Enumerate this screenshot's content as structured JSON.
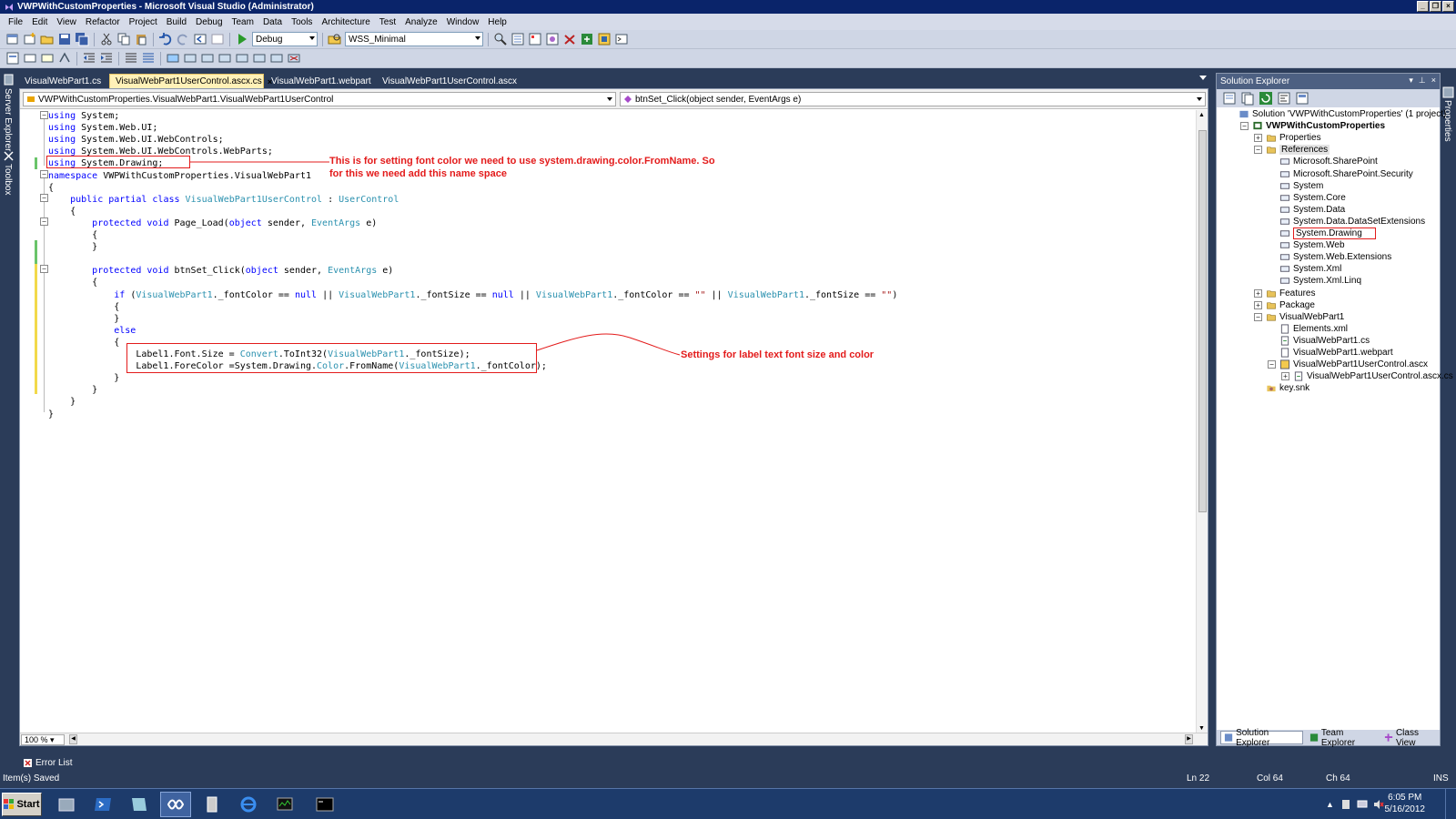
{
  "window": {
    "title": "VWPWithCustomProperties - Microsoft Visual Studio (Administrator)"
  },
  "menu": [
    "File",
    "Edit",
    "View",
    "Refactor",
    "Project",
    "Build",
    "Debug",
    "Team",
    "Data",
    "Tools",
    "Architecture",
    "Test",
    "Analyze",
    "Window",
    "Help"
  ],
  "toolbar": {
    "config": "Debug",
    "platform": "WSS_Minimal"
  },
  "side_tabs": {
    "server_explorer": "Server Explorer",
    "toolbox": "Toolbox",
    "properties": "Properties"
  },
  "tabs": [
    {
      "label": "VisualWebPart1.cs"
    },
    {
      "label": "VisualWebPart1UserControl.ascx.cs",
      "close": "×"
    },
    {
      "label": "VisualWebPart1.webpart"
    },
    {
      "label": "VisualWebPart1UserControl.ascx"
    }
  ],
  "nav": {
    "type": "VWPWithCustomProperties.VisualWebPart1.VisualWebPart1UserControl",
    "member": "btnSet_Click(object sender, EventArgs e)"
  },
  "code": [
    {
      "t": [
        [
          "kw",
          "using"
        ],
        [
          "",
          "System;"
        ]
      ]
    },
    {
      "t": [
        [
          "kw",
          "using"
        ],
        [
          "",
          "System.Web.UI;"
        ]
      ]
    },
    {
      "t": [
        [
          "kw",
          "using"
        ],
        [
          "",
          "System.Web.UI.WebControls;"
        ]
      ]
    },
    {
      "t": [
        [
          "kw",
          "using"
        ],
        [
          "",
          "System.Web.UI.WebControls.WebParts;"
        ]
      ]
    },
    {
      "t": [
        [
          "kw",
          "using"
        ],
        [
          "",
          "System.Drawing;"
        ]
      ]
    },
    {
      "t": [
        [
          "kw",
          "namespace"
        ],
        [
          "",
          "VWPWithCustomProperties.VisualWebPart1"
        ]
      ]
    },
    {
      "t": [
        [
          "",
          "{"
        ]
      ]
    },
    {
      "t": [
        [
          "",
          "    "
        ],
        [
          "kw",
          "public partial class"
        ],
        [
          "",
          " "
        ],
        [
          "ty",
          "VisualWebPart1UserControl"
        ],
        [
          "",
          " : "
        ],
        [
          "ty",
          "UserControl"
        ]
      ]
    },
    {
      "t": [
        [
          "",
          "    {"
        ]
      ]
    },
    {
      "t": [
        [
          "",
          "        "
        ],
        [
          "kw",
          "protected void"
        ],
        [
          "",
          " Page_Load("
        ],
        [
          "kw",
          "object"
        ],
        [
          "",
          " sender, "
        ],
        [
          "ty",
          "EventArgs"
        ],
        [
          "",
          " e)"
        ]
      ]
    },
    {
      "t": [
        [
          "",
          "        {"
        ]
      ]
    },
    {
      "t": [
        [
          "",
          "        }"
        ]
      ]
    },
    {
      "t": [
        [
          "",
          ""
        ]
      ]
    },
    {
      "t": [
        [
          "",
          "        "
        ],
        [
          "kw",
          "protected void"
        ],
        [
          "",
          " btnSet_Click("
        ],
        [
          "kw",
          "object"
        ],
        [
          "",
          " sender, "
        ],
        [
          "ty",
          "EventArgs"
        ],
        [
          "",
          " e)"
        ]
      ]
    },
    {
      "t": [
        [
          "",
          "        {"
        ]
      ]
    },
    {
      "t": [
        [
          "",
          "            "
        ],
        [
          "kw",
          "if"
        ],
        [
          "",
          " ("
        ],
        [
          "ty",
          "VisualWebPart1"
        ],
        [
          "",
          "._fontColor == "
        ],
        [
          "kw",
          "null"
        ],
        [
          "",
          " || "
        ],
        [
          "ty",
          "VisualWebPart1"
        ],
        [
          "",
          "._fontSize == "
        ],
        [
          "kw",
          "null"
        ],
        [
          "",
          " || "
        ],
        [
          "ty",
          "VisualWebPart1"
        ],
        [
          "",
          "._fontColor == "
        ],
        [
          "str",
          "\"\""
        ],
        [
          "",
          " || "
        ],
        [
          "ty",
          "VisualWebPart1"
        ],
        [
          "",
          "._fontSize == "
        ],
        [
          "str",
          "\"\""
        ],
        [
          "",
          ")"
        ]
      ]
    },
    {
      "t": [
        [
          "",
          "            {"
        ]
      ]
    },
    {
      "t": [
        [
          "",
          "            }"
        ]
      ]
    },
    {
      "t": [
        [
          "",
          "            "
        ],
        [
          "kw",
          "else"
        ]
      ]
    },
    {
      "t": [
        [
          "",
          "            {"
        ]
      ]
    },
    {
      "t": [
        [
          "",
          "                Label1.Font.Size = "
        ],
        [
          "ty",
          "Convert"
        ],
        [
          "",
          ".ToInt32("
        ],
        [
          "ty",
          "VisualWebPart1"
        ],
        [
          "",
          "._fontSize);"
        ]
      ]
    },
    {
      "t": [
        [
          "",
          "                Label1.ForeColor =System.Drawing."
        ],
        [
          "ty",
          "Color"
        ],
        [
          "",
          ".FromName("
        ],
        [
          "ty",
          "VisualWebPart1"
        ],
        [
          "",
          "._fontColor);"
        ]
      ]
    },
    {
      "t": [
        [
          "",
          "            }"
        ]
      ]
    },
    {
      "t": [
        [
          "",
          "        }"
        ]
      ]
    },
    {
      "t": [
        [
          "",
          "    }"
        ]
      ]
    },
    {
      "t": [
        [
          "",
          "}"
        ]
      ]
    }
  ],
  "annotations": {
    "namespace_note_1": "This is for setting font color we need to use system.drawing.color.FromName. So",
    "namespace_note_2": "for this we need add this name space",
    "label_note": "Settings for label text font size and color"
  },
  "zoom": "100 %",
  "solution_explorer": {
    "title": "Solution Explorer",
    "items": [
      {
        "label": "Solution 'VWPWithCustomProperties' (1 project)",
        "indent": 0,
        "icon": "solution"
      },
      {
        "label": "VWPWithCustomProperties",
        "indent": 1,
        "bold": true,
        "exp": "−",
        "icon": "project"
      },
      {
        "label": "Properties",
        "indent": 2,
        "exp": "+",
        "icon": "folder"
      },
      {
        "label": "References",
        "indent": 2,
        "exp": "−",
        "icon": "folder",
        "selected": true
      },
      {
        "label": "Microsoft.SharePoint",
        "indent": 3,
        "icon": "ref"
      },
      {
        "label": "Microsoft.SharePoint.Security",
        "indent": 3,
        "icon": "ref"
      },
      {
        "label": "System",
        "indent": 3,
        "icon": "ref"
      },
      {
        "label": "System.Core",
        "indent": 3,
        "icon": "ref"
      },
      {
        "label": "System.Data",
        "indent": 3,
        "icon": "ref"
      },
      {
        "label": "System.Data.DataSetExtensions",
        "indent": 3,
        "icon": "ref"
      },
      {
        "label": "System.Drawing",
        "indent": 3,
        "icon": "ref",
        "highlight": true
      },
      {
        "label": "System.Web",
        "indent": 3,
        "icon": "ref"
      },
      {
        "label": "System.Web.Extensions",
        "indent": 3,
        "icon": "ref"
      },
      {
        "label": "System.Xml",
        "indent": 3,
        "icon": "ref"
      },
      {
        "label": "System.Xml.Linq",
        "indent": 3,
        "icon": "ref"
      },
      {
        "label": "Features",
        "indent": 2,
        "exp": "+",
        "icon": "folder"
      },
      {
        "label": "Package",
        "indent": 2,
        "exp": "+",
        "icon": "folder"
      },
      {
        "label": "VisualWebPart1",
        "indent": 2,
        "exp": "−",
        "icon": "folder"
      },
      {
        "label": "Elements.xml",
        "indent": 3,
        "icon": "file"
      },
      {
        "label": "VisualWebPart1.cs",
        "indent": 3,
        "icon": "cs"
      },
      {
        "label": "VisualWebPart1.webpart",
        "indent": 3,
        "icon": "file"
      },
      {
        "label": "VisualWebPart1UserControl.ascx",
        "indent": 3,
        "exp": "−",
        "icon": "ascx"
      },
      {
        "label": "VisualWebPart1UserControl.ascx.cs",
        "indent": 4,
        "exp": "+",
        "icon": "cs"
      },
      {
        "label": "key.snk",
        "indent": 2,
        "icon": "key"
      }
    ],
    "tabs": [
      "Solution Explorer",
      "Team Explorer",
      "Class View"
    ]
  },
  "error_list": "Error List",
  "status": {
    "message": "Item(s) Saved",
    "line": "Ln 22",
    "col": "Col 64",
    "ch": "Ch 64",
    "mode": "INS"
  },
  "taskbar": {
    "start": "Start",
    "time": "6:05 PM",
    "date": "5/16/2012"
  }
}
